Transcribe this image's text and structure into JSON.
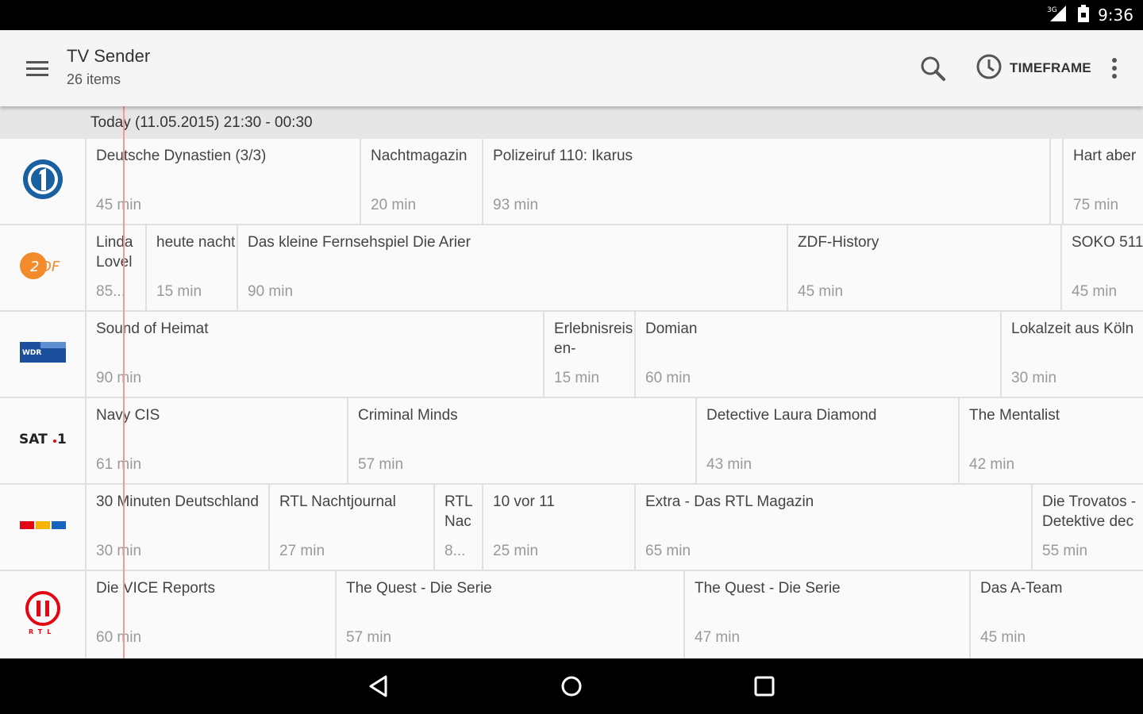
{
  "status": {
    "time": "9:36",
    "network": "3G"
  },
  "appbar": {
    "title": "TV Sender",
    "subtitle": "26 items",
    "timeframe_label": "TIMEFRAME",
    "icons": [
      "menu-icon",
      "search-icon",
      "clock-icon",
      "overflow-icon"
    ]
  },
  "date_header": "Today  (11.05.2015)  21:30 - 00:30",
  "channels": [
    {
      "name": "Das Erste",
      "logo": "das-erste-logo",
      "programs": [
        {
          "title": "Deutsche Dynastien (3/3)",
          "duration": "45 min"
        },
        {
          "title": "Nachtmagazin",
          "duration": "20 min"
        },
        {
          "title": "Polizeiruf 110: Ikarus",
          "duration": "93 min"
        },
        {
          "title": "Hart aber",
          "duration": "75 min"
        }
      ]
    },
    {
      "name": "ZDF",
      "logo": "zdf-logo",
      "programs": [
        {
          "title": "Linda Lovel",
          "duration": "85..."
        },
        {
          "title": "heute nacht",
          "duration": "15 min"
        },
        {
          "title": "Das kleine Fernsehspiel Die Arier",
          "duration": "90 min"
        },
        {
          "title": "ZDF-History",
          "duration": "45 min"
        },
        {
          "title": "SOKO 511",
          "duration": "45 min"
        }
      ]
    },
    {
      "name": "WDR",
      "logo": "wdr-logo",
      "programs": [
        {
          "title": "Sound of Heimat",
          "duration": "90 min"
        },
        {
          "title": "Erlebnisreisen-",
          "duration": "15 min"
        },
        {
          "title": "Domian",
          "duration": "60 min"
        },
        {
          "title": "Lokalzeit aus Köln",
          "duration": "30 min"
        }
      ]
    },
    {
      "name": "SAT.1",
      "logo": "sat1-logo",
      "programs": [
        {
          "title": "Navy CIS",
          "duration": "61 min"
        },
        {
          "title": "Criminal Minds",
          "duration": "57 min"
        },
        {
          "title": "Detective Laura Diamond",
          "duration": "43 min"
        },
        {
          "title": "The Mentalist",
          "duration": "42 min"
        }
      ]
    },
    {
      "name": "RTL",
      "logo": "rtl-logo",
      "programs": [
        {
          "title": "30 Minuten Deutschland",
          "duration": "30 min"
        },
        {
          "title": "RTL Nachtjournal",
          "duration": "27 min"
        },
        {
          "title": "RTL Nac",
          "duration": "8..."
        },
        {
          "title": "10 vor 11",
          "duration": "25 min"
        },
        {
          "title": "Extra - Das RTL Magazin",
          "duration": "65 min"
        },
        {
          "title": "Die Trovatos - Detektive dec",
          "duration": "55 min"
        }
      ]
    },
    {
      "name": "RTL II",
      "logo": "rtl2-logo",
      "programs": [
        {
          "title": "Die VICE Reports",
          "duration": "60 min"
        },
        {
          "title": "The Quest - Die Serie",
          "duration": "57 min"
        },
        {
          "title": "The Quest - Die Serie",
          "duration": "47 min"
        },
        {
          "title": "Das A-Team",
          "duration": "45 min"
        }
      ]
    }
  ],
  "colors": {
    "accent": "#ef9a9a",
    "zdf": "#f28b2c",
    "wdr": "#1b4f9c",
    "rtl2": "#e30613"
  }
}
